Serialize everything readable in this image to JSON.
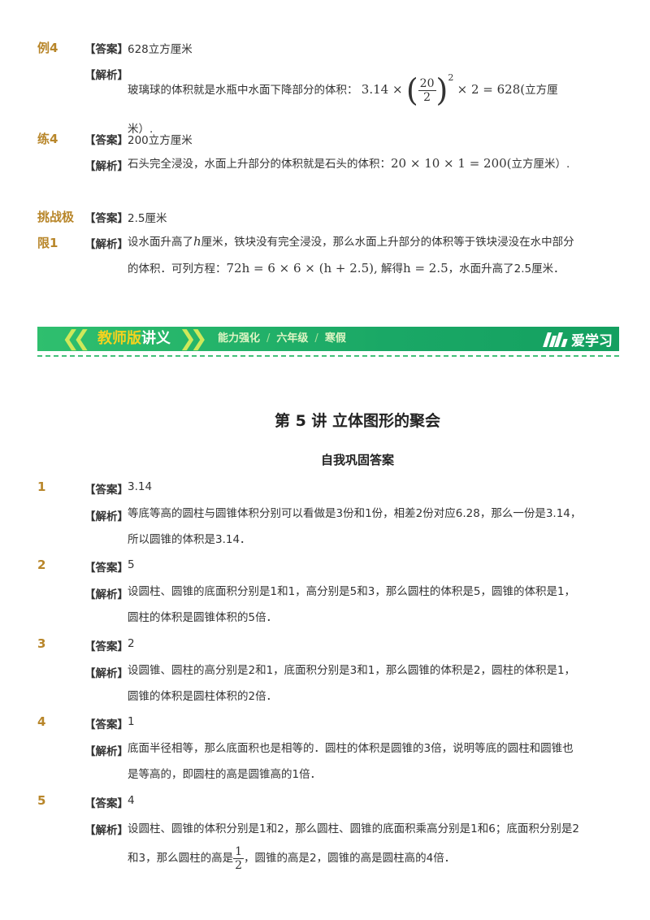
{
  "top_items": [
    {
      "label": "例4",
      "answer_tag": "【答案】",
      "answer": "628立方厘米",
      "explain_tag": "【解析】",
      "explain_pre": "玻璃球的体积就是水瓶中水面下降部分的体积：",
      "explain_math_a": "3.14 ×",
      "frac_num": "20",
      "frac_den": "2",
      "power": "2",
      "explain_math_b": "× 2 = 628(",
      "explain_post": "立方厘米）."
    },
    {
      "label": "练4",
      "answer_tag": "【答案】",
      "answer": "200立方厘米",
      "explain_tag": "【解析】",
      "explain_pre": "石头完全浸没，水面上升部分的体积就是石头的体积：",
      "explain_math": "20 × 10 × 1 = 200(",
      "explain_post": "立方厘米）."
    },
    {
      "label_line1": "挑战极",
      "label_line2": "限1",
      "answer_tag": "【答案】",
      "answer": "2.5厘米",
      "explain_tag": "【解析】",
      "explain_1": "设水面升高了",
      "var_h": "h",
      "explain_2": "厘米，铁块没有完全浸没，那么水面上升部分的体积等于铁块浸没在水中部分的体积．可列方程：",
      "equation": "72h = 6 × 6 × (h + 2.5),",
      "explain_3": "解得",
      "solution": "h = 2.5",
      "explain_4": "，水面升高了2.5厘米．"
    }
  ],
  "banner": {
    "title_a": "教师版",
    "title_b": "讲义",
    "sub_1": "能力强化",
    "sep": "/",
    "sub_2": "六年级",
    "sub_3": "寒假",
    "logo_text": "爱学习"
  },
  "lecture_title": "第 5 讲  立体图形的聚会",
  "section_title": "自我巩固答案",
  "answers": [
    {
      "num": "1",
      "answer_tag": "【答案】",
      "answer": "3.14",
      "explain_tag": "【解析】",
      "explain": "等底等高的圆柱与圆锥体积分别可以看做是3份和1份，相差2份对应6.28，那么一份是3.14，所以圆锥的体积是3.14．"
    },
    {
      "num": "2",
      "answer_tag": "【答案】",
      "answer": "5",
      "explain_tag": "【解析】",
      "explain": "设圆柱、圆锥的底面积分别是1和1，高分别是5和3，那么圆柱的体积是5，圆锥的体积是1，圆柱的体积是圆锥体积的5倍．"
    },
    {
      "num": "3",
      "answer_tag": "【答案】",
      "answer": "2",
      "explain_tag": "【解析】",
      "explain": "设圆锥、圆柱的高分别是2和1，底面积分别是3和1，那么圆锥的体积是2，圆柱的体积是1，圆锥的体积是圆柱体积的2倍．"
    },
    {
      "num": "4",
      "answer_tag": "【答案】",
      "answer": "1",
      "explain_tag": "【解析】",
      "explain": "底面半径相等，那么底面积也是相等的．圆柱的体积是圆锥的3倍，说明等底的圆柱和圆锥也是等高的，即圆柱的高是圆锥高的1倍．"
    },
    {
      "num": "5",
      "answer_tag": "【答案】",
      "answer": "4",
      "explain_tag": "【解析】",
      "explain_1": "设圆柱、圆锥的体积分别是1和2，那么圆柱、圆锥的底面积乘高分别是1和6；底面积分别是2和3，那么圆柱的高是",
      "frac_num": "1",
      "frac_den": "2",
      "explain_2": "，圆锥的高是2，圆锥的高是圆柱高的4倍．"
    }
  ]
}
